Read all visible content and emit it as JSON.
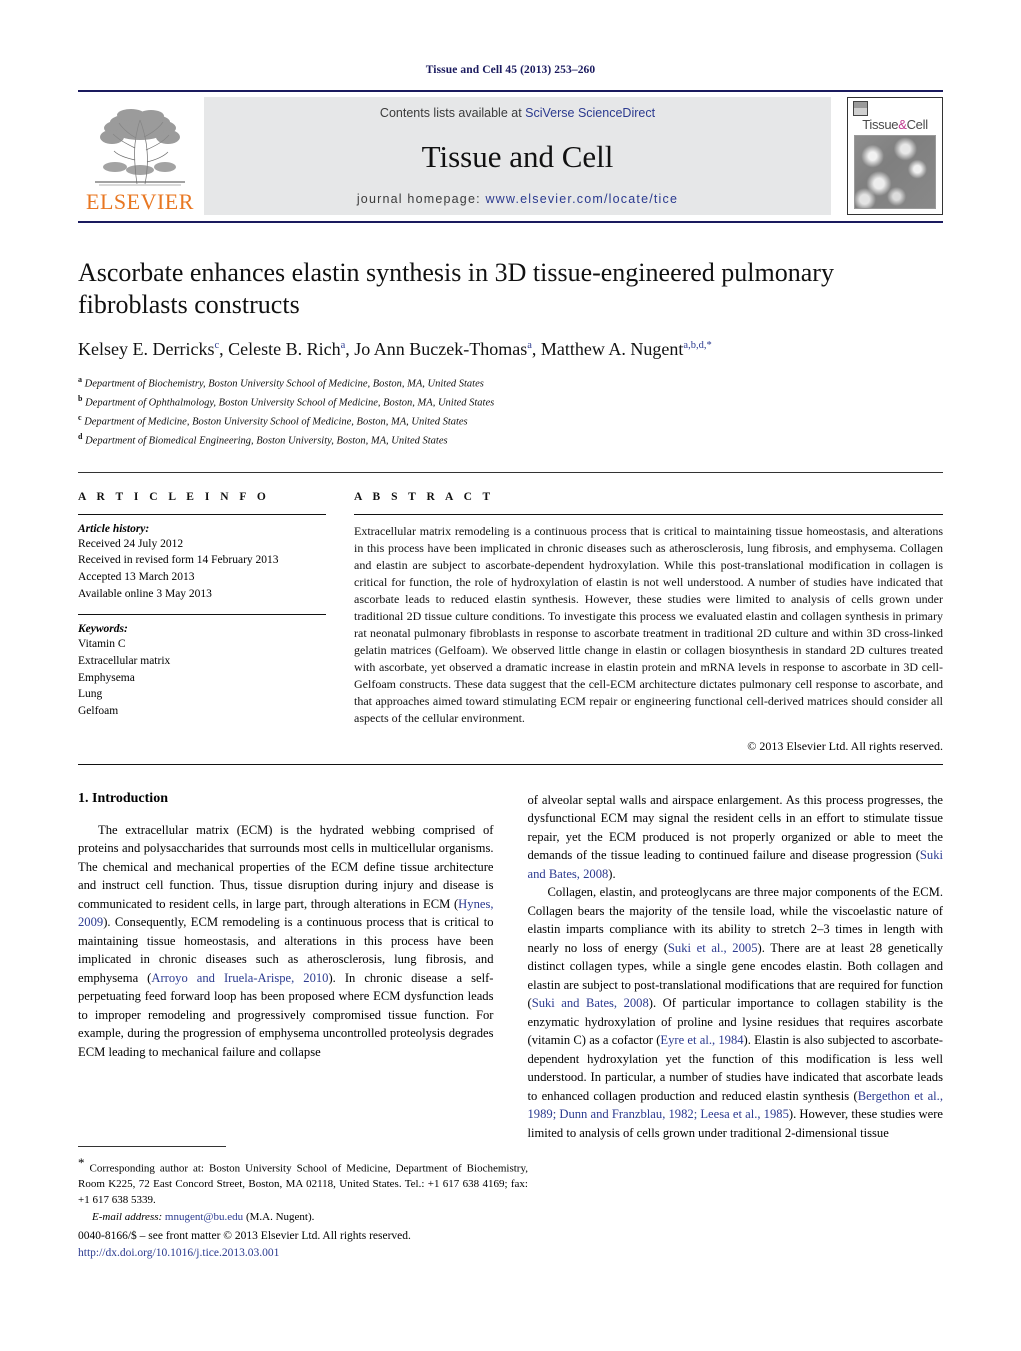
{
  "running_head": "Tissue and Cell 45 (2013) 253–260",
  "masthead": {
    "publisher_name": "ELSEVIER",
    "contents_prefix": "Contents lists available at ",
    "contents_link": "SciVerse ScienceDirect",
    "journal_name": "Tissue and Cell",
    "homepage_prefix": "journal homepage: ",
    "homepage_url": "www.elsevier.com/locate/tice",
    "cover_title_left": "Tissue",
    "cover_title_amp": "&",
    "cover_title_right": "Cell",
    "link_color": "#2b3a8f",
    "brand_orange": "#E87722",
    "band_gray": "#e6e7e8",
    "rule_navy": "#1a1a5e"
  },
  "article": {
    "title": "Ascorbate enhances elastin synthesis in 3D tissue-engineered pulmonary fibroblasts constructs",
    "authors_html": "Kelsey E. Derricks<sup>c</sup>, Celeste B. Rich<sup>a</sup>, Jo Ann Buczek-Thomas<sup>a</sup>, Matthew A. Nugent<sup>a,b,d,</sup><sup>*</sup>",
    "affiliations": [
      {
        "marker": "a",
        "text": "Department of Biochemistry, Boston University School of Medicine, Boston, MA, United States"
      },
      {
        "marker": "b",
        "text": "Department of Ophthalmology, Boston University School of Medicine, Boston, MA, United States"
      },
      {
        "marker": "c",
        "text": "Department of Medicine, Boston University School of Medicine, Boston, MA, United States"
      },
      {
        "marker": "d",
        "text": "Department of Biomedical Engineering, Boston University, Boston, MA, United States"
      }
    ]
  },
  "article_info": {
    "heading": "A R T I C L E   I N F O",
    "history_label": "Article history:",
    "history": [
      "Received 24 July 2012",
      "Received in revised form 14 February 2013",
      "Accepted 13 March 2013",
      "Available online 3 May 2013"
    ],
    "keywords_label": "Keywords:",
    "keywords": [
      "Vitamin C",
      "Extracellular matrix",
      "Emphysema",
      "Lung",
      "Gelfoam"
    ]
  },
  "abstract": {
    "heading": "A B S T R A C T",
    "text": "Extracellular matrix remodeling is a continuous process that is critical to maintaining tissue homeostasis, and alterations in this process have been implicated in chronic diseases such as atherosclerosis, lung fibrosis, and emphysema. Collagen and elastin are subject to ascorbate-dependent hydroxylation. While this post-translational modification in collagen is critical for function, the role of hydroxylation of elastin is not well understood. A number of studies have indicated that ascorbate leads to reduced elastin synthesis. However, these studies were limited to analysis of cells grown under traditional 2D tissue culture conditions. To investigate this process we evaluated elastin and collagen synthesis in primary rat neonatal pulmonary fibroblasts in response to ascorbate treatment in traditional 2D culture and within 3D cross-linked gelatin matrices (Gelfoam). We observed little change in elastin or collagen biosynthesis in standard 2D cultures treated with ascorbate, yet observed a dramatic increase in elastin protein and mRNA levels in response to ascorbate in 3D cell-Gelfoam constructs. These data suggest that the cell-ECM architecture dictates pulmonary cell response to ascorbate, and that approaches aimed toward stimulating ECM repair or engineering functional cell-derived matrices should consider all aspects of the cellular environment.",
    "copyright": "© 2013 Elsevier Ltd. All rights reserved."
  },
  "introduction": {
    "heading": "1.  Introduction",
    "left_paragraph_1_a": "The extracellular matrix (ECM) is the hydrated webbing comprised of proteins and polysaccharides that surrounds most cells in multicellular organisms. The chemical and mechanical properties of the ECM define tissue architecture and instruct cell function. Thus, tissue disruption during injury and disease is communicated to resident cells, in large part, through alterations in ECM (",
    "left_cite_1": "Hynes, 2009",
    "left_paragraph_1_b": "). Consequently, ECM remodeling is a continuous process that is critical to maintaining tissue homeostasis, and alterations in this process have been implicated in chronic diseases such as atherosclerosis, lung fibrosis, and emphysema (",
    "left_cite_2": "Arroyo and Iruela-Arispe, 2010",
    "left_paragraph_1_c": "). In chronic disease a self-perpetuating feed forward loop has been proposed where ECM dysfunction leads to improper remodeling and progressively compromised tissue function. For example, during the progression of emphysema uncontrolled proteolysis degrades ECM leading to mechanical failure and collapse",
    "right_paragraph_1_a": "of alveolar septal walls and airspace enlargement. As this process progresses, the dysfunctional ECM may signal the resident cells in an effort to stimulate tissue repair, yet the ECM produced is not properly organized or able to meet the demands of the tissue leading to continued failure and disease progression (",
    "right_cite_1": "Suki and Bates, 2008",
    "right_paragraph_1_b": ").",
    "right_paragraph_2_a": "Collagen, elastin, and proteoglycans are three major components of the ECM. Collagen bears the majority of the tensile load, while the viscoelastic nature of elastin imparts compliance with its ability to stretch 2–3 times in length with nearly no loss of energy (",
    "right_cite_2": "Suki et al., 2005",
    "right_paragraph_2_b": "). There are at least 28 genetically distinct collagen types, while a single gene encodes elastin. Both collagen and elastin are subject to post-translational modifications that are required for function (",
    "right_cite_3": "Suki and Bates, 2008",
    "right_paragraph_2_c": "). Of particular importance to collagen stability is the enzymatic hydroxylation of proline and lysine residues that requires ascorbate (vitamin C) as a cofactor (",
    "right_cite_4": "Eyre et al., 1984",
    "right_paragraph_2_d": "). Elastin is also subjected to ascorbate-dependent hydroxylation yet the function of this modification is less well understood. In particular, a number of studies have indicated that ascorbate leads to enhanced collagen production and reduced elastin synthesis (",
    "right_cite_5": "Bergethon et al., 1989; Dunn and Franzblau, 1982; Leesa et al., 1985",
    "right_paragraph_2_e": "). However, these studies were limited to analysis of cells grown under traditional 2-dimensional tissue"
  },
  "footnote": {
    "corresponding_marker": "*",
    "corresponding_text": " Corresponding author at: Boston University School of Medicine, Department of Biochemistry, Room K225, 72 East Concord Street, Boston, MA 02118, United States. Tel.: +1 617 638 4169; fax: +1 617 638 5339.",
    "email_label": "E-mail address:",
    "email": "mnugent@bu.edu",
    "email_suffix": " (M.A. Nugent)."
  },
  "footer": {
    "issn_line": "0040-8166/$ – see front matter © 2013 Elsevier Ltd. All rights reserved.",
    "doi": "http://dx.doi.org/10.1016/j.tice.2013.03.001"
  }
}
